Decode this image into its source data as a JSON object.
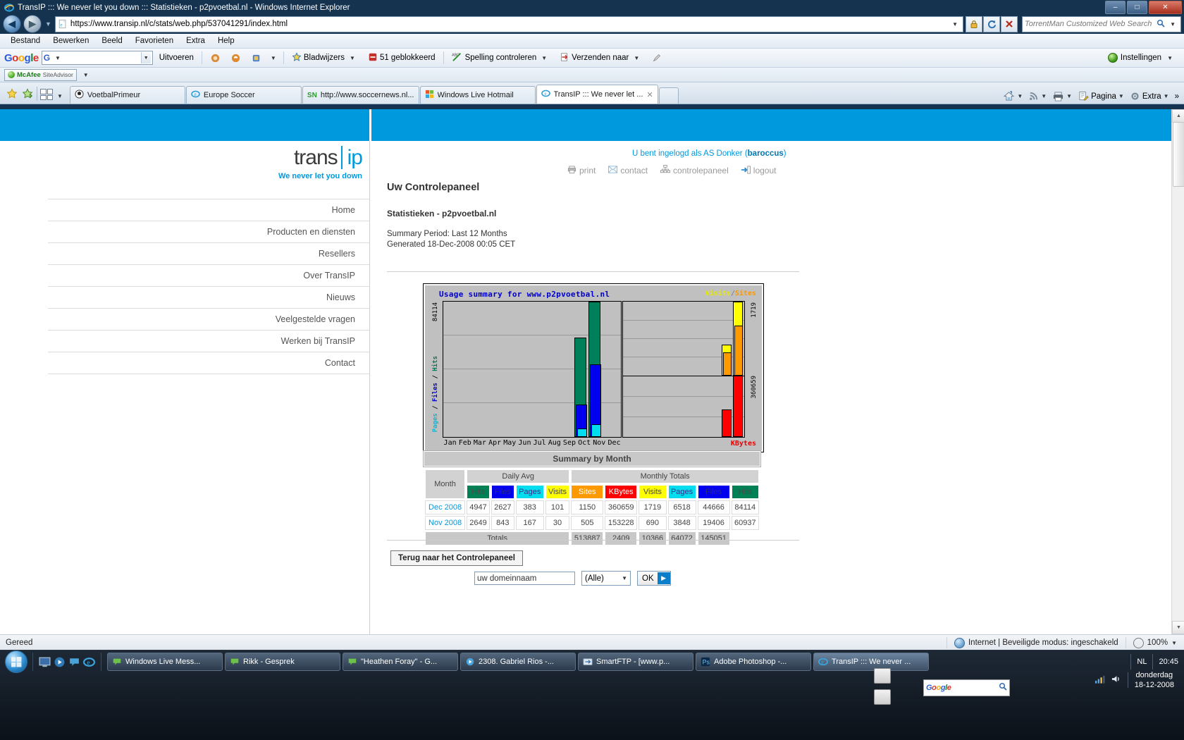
{
  "window": {
    "title": "TransIP ::: We never let you down ::: Statistieken - p2pvoetbal.nl - Windows Internet Explorer",
    "minimize": "–",
    "maximize": "□",
    "close": "✕"
  },
  "address": {
    "url": "https://www.transip.nl/c/stats/web.php/537041291/index.html",
    "search_placeholder": "TorrentMan Customized Web Search",
    "refresh_icon": "refresh-icon",
    "stop_icon": "stop-icon",
    "lock_icon": "lock-icon"
  },
  "menubar": [
    "Bestand",
    "Bewerken",
    "Beeld",
    "Favorieten",
    "Extra",
    "Help"
  ],
  "google_toolbar": {
    "logo": "Google",
    "input_value": "",
    "run_label": "Uitvoeren",
    "bookmarks_label": "Bladwijzers",
    "blocked_label": "51 geblokkeerd",
    "spelling_label": "Spelling controleren",
    "send_to_label": "Verzenden naar",
    "settings_label": "Instellingen"
  },
  "mcafee": {
    "brand": "McAfee",
    "product": "SiteAdvisor"
  },
  "tabs": [
    {
      "label": "VoetbalPrimeur",
      "icon": "soccer-ball-icon",
      "active": false
    },
    {
      "label": "Europe Soccer",
      "icon": "ie-icon",
      "active": false
    },
    {
      "label": "http://www.soccernews.nl...",
      "icon": "sn-icon",
      "active": false
    },
    {
      "label": "Windows Live Hotmail",
      "icon": "hotmail-icon",
      "active": false
    },
    {
      "label": "TransIP ::: We never let ...",
      "icon": "ie-icon",
      "active": true
    }
  ],
  "tab_tools": {
    "home_label": "",
    "feeds_label": "",
    "print_label": "",
    "page_label": "Pagina",
    "extra_label": "Extra",
    "overflow": "»"
  },
  "page": {
    "logo_left": "trans",
    "logo_right": "ip",
    "tagline": "We never let you down",
    "nav": [
      "Home",
      "Producten en diensten",
      "Resellers",
      "Over TransIP",
      "Nieuws",
      "Veelgestelde vragen",
      "Werken bij TransIP",
      "Contact"
    ],
    "login_prefix": "U bent ingelogd als AS Donker (",
    "login_user": "baroccus",
    "login_suffix": ")",
    "top_links": [
      {
        "label": "print",
        "icon": "printer-icon"
      },
      {
        "label": "contact",
        "icon": "envelope-icon"
      },
      {
        "label": "controlepaneel",
        "icon": "sitemap-icon"
      },
      {
        "label": "logout",
        "icon": "exit-icon"
      }
    ],
    "heading": "Uw Controlepaneel",
    "subheading": "Statistieken - p2pvoetbal.nl",
    "summary_period": "Summary Period: Last 12 Months",
    "generated": "Generated 18-Dec-2008 00:05 CET",
    "back_button": "Terug naar het Controlepaneel",
    "domain_input_value": "uw domeinnaam",
    "select_value": "(Alle)",
    "ok_button": "OK",
    "ok_arrow": "▶"
  },
  "chart_data": {
    "type": "bar",
    "title": "Usage summary for www.p2pvoetbal.nl",
    "legend": {
      "visits": "Visits",
      "separator": "/",
      "sites": "Sites",
      "kbytes": "KBytes"
    },
    "left_axis_label": "Pages / Files / Hits",
    "left_axis_max_label": "84114",
    "right_top_max_label": "1719",
    "right_bottom_max_label": "360659",
    "categories": [
      "Jan",
      "Feb",
      "Mar",
      "Apr",
      "May",
      "Jun",
      "Jul",
      "Aug",
      "Sep",
      "Oct",
      "Nov",
      "Dec"
    ],
    "xlabel": "",
    "ylabel": "Pages / Files / Hits",
    "grid": true,
    "series": [
      {
        "name": "Hits",
        "color": "#00805a",
        "values": [
          0,
          0,
          0,
          0,
          0,
          0,
          0,
          0,
          0,
          0,
          60937,
          84114
        ],
        "ylim": [
          0,
          84114
        ]
      },
      {
        "name": "Files",
        "color": "#0000ee",
        "values": [
          0,
          0,
          0,
          0,
          0,
          0,
          0,
          0,
          0,
          0,
          19406,
          44666
        ],
        "ylim": [
          0,
          84114
        ]
      },
      {
        "name": "Pages",
        "color": "#00ddee",
        "values": [
          0,
          0,
          0,
          0,
          0,
          0,
          0,
          0,
          0,
          0,
          3848,
          6518
        ],
        "ylim": [
          0,
          84114
        ]
      },
      {
        "name": "Visits",
        "color": "#ffff00",
        "values": [
          0,
          0,
          0,
          0,
          0,
          0,
          0,
          0,
          0,
          0,
          690,
          1719
        ],
        "ylim": [
          0,
          1719
        ]
      },
      {
        "name": "Sites",
        "color": "#ff9900",
        "values": [
          0,
          0,
          0,
          0,
          0,
          0,
          0,
          0,
          0,
          0,
          505,
          1150
        ],
        "ylim": [
          0,
          1719
        ]
      },
      {
        "name": "KBytes",
        "color": "#ff0000",
        "values": [
          0,
          0,
          0,
          0,
          0,
          0,
          0,
          0,
          0,
          0,
          153228,
          360659
        ],
        "ylim": [
          0,
          360659
        ]
      }
    ]
  },
  "table": {
    "title": "Summary by Month",
    "group_month": "Month",
    "group_daily": "Daily Avg",
    "group_monthly": "Monthly Totals",
    "headers": [
      "Hits",
      "Files",
      "Pages",
      "Visits",
      "Sites",
      "KBytes",
      "Visits",
      "Pages",
      "Files",
      "Hits"
    ],
    "rows": [
      {
        "month": "Dec 2008",
        "cells": [
          "4947",
          "2627",
          "383",
          "101",
          "1150",
          "360659",
          "1719",
          "6518",
          "44666",
          "84114"
        ]
      },
      {
        "month": "Nov 2008",
        "cells": [
          "2649",
          "843",
          "167",
          "30",
          "505",
          "153228",
          "690",
          "3848",
          "19406",
          "60937"
        ]
      }
    ],
    "totals_label": "Totals",
    "totals": [
      "",
      "",
      "",
      "",
      "",
      "513887",
      "2409",
      "10366",
      "64072",
      "145051"
    ]
  },
  "statusbar": {
    "status": "Gereed",
    "zone": "Internet | Beveiligde modus: ingeschakeld",
    "zoom": "100%"
  },
  "taskbar": {
    "items": [
      {
        "label": "Windows Live Mess...",
        "icon": "messenger-icon",
        "active": false
      },
      {
        "label": "Rikk - Gesprek",
        "icon": "messenger-icon",
        "active": false
      },
      {
        "label": "\"Heathen Foray\" - G...",
        "icon": "messenger-icon",
        "active": false
      },
      {
        "label": "2308. Gabriel Rios -...",
        "icon": "media-icon",
        "active": false
      },
      {
        "label": "SmartFTP - [www.p...",
        "icon": "ftp-icon",
        "active": false
      },
      {
        "label": "Adobe Photoshop -...",
        "icon": "photoshop-icon",
        "active": false
      },
      {
        "label": "TransIP ::: We never ...",
        "icon": "ie-icon",
        "active": true
      }
    ],
    "language": "NL",
    "clock_time": "20:45",
    "clock_day": "donderdag",
    "clock_date": "18-12-2008",
    "google_gadget": "Google"
  }
}
